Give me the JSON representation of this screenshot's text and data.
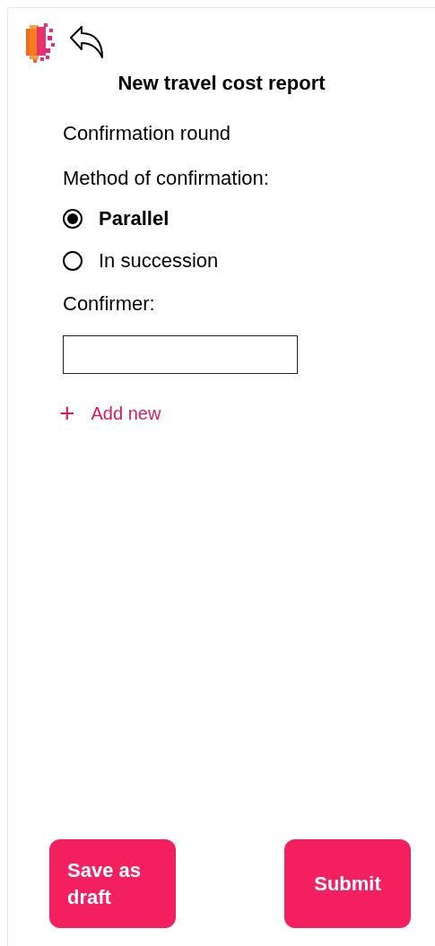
{
  "title": "New travel cost report",
  "section": "Confirmation round",
  "method_label": "Method of confirmation:",
  "methods": [
    {
      "label": "Parallel",
      "selected": true
    },
    {
      "label": "In succession",
      "selected": false
    }
  ],
  "confirmer_label": "Confirmer:",
  "add_new": {
    "icon": "+",
    "label": "Add new"
  },
  "buttons": [
    {
      "label": "Save as draft"
    },
    {
      "label": "Submit"
    }
  ]
}
